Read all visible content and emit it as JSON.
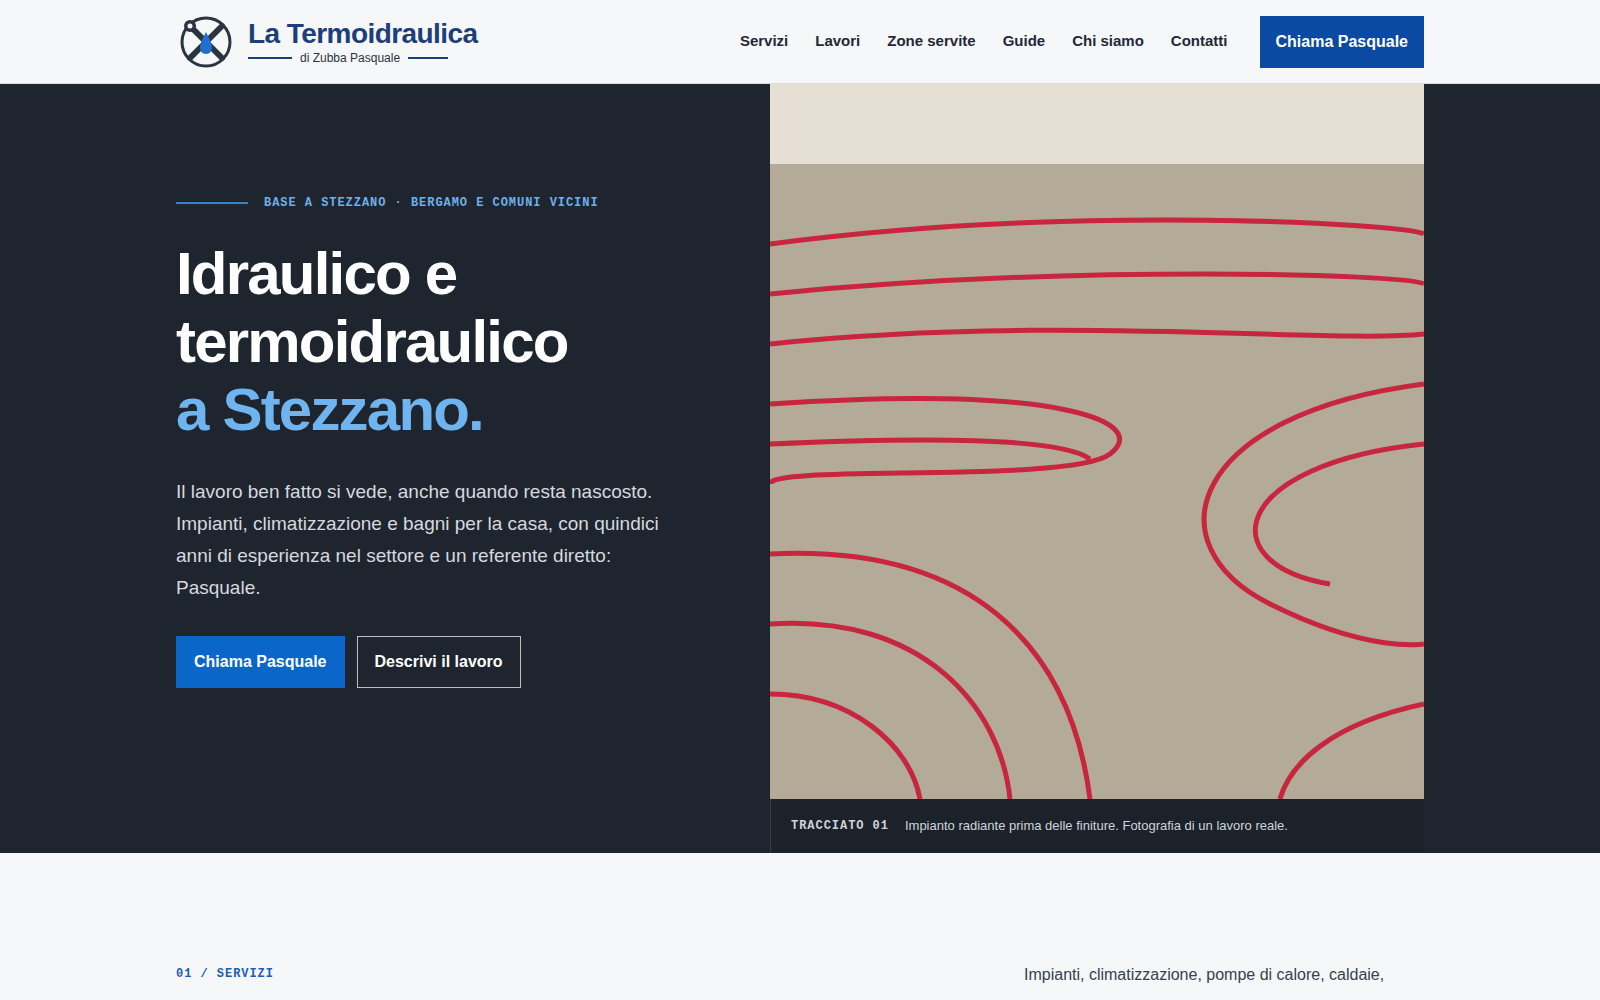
{
  "header": {
    "logo": {
      "title": "La Termoidraulica",
      "subtitle": "di Zubba Pasquale"
    },
    "nav": [
      {
        "label": "Servizi"
      },
      {
        "label": "Lavori"
      },
      {
        "label": "Zone servite"
      },
      {
        "label": "Guide"
      },
      {
        "label": "Chi siamo"
      },
      {
        "label": "Contatti"
      }
    ],
    "cta": "Chiama Pasquale"
  },
  "hero": {
    "eyebrow": "BASE A STEZZANO · BERGAMO E COMUNI VICINI",
    "title_lines": [
      "Idraulico e",
      "termoidraulico"
    ],
    "title_accent": "a Stezzano.",
    "lead": "Il lavoro ben fatto si vede, anche quando resta nascosto. Impianti, climatizzazione e bagni per la casa, con quindici anni di esperienza nel settore e un referente diretto: Pasquale.",
    "buttons": [
      {
        "label": "Chiama Pasquale",
        "kind": "primary"
      },
      {
        "label": "Descrivi il lavoro",
        "kind": "secondary"
      }
    ],
    "photo": {
      "tag": "TRACCIATO 01",
      "caption": "Impianto radiante prima delle finiture. Fotografia di un lavoro reale."
    }
  },
  "services": {
    "eyebrow": "01 / SERVIZI",
    "intro": "Impianti, climatizzazione, pompe di calore, caldaie,"
  }
}
